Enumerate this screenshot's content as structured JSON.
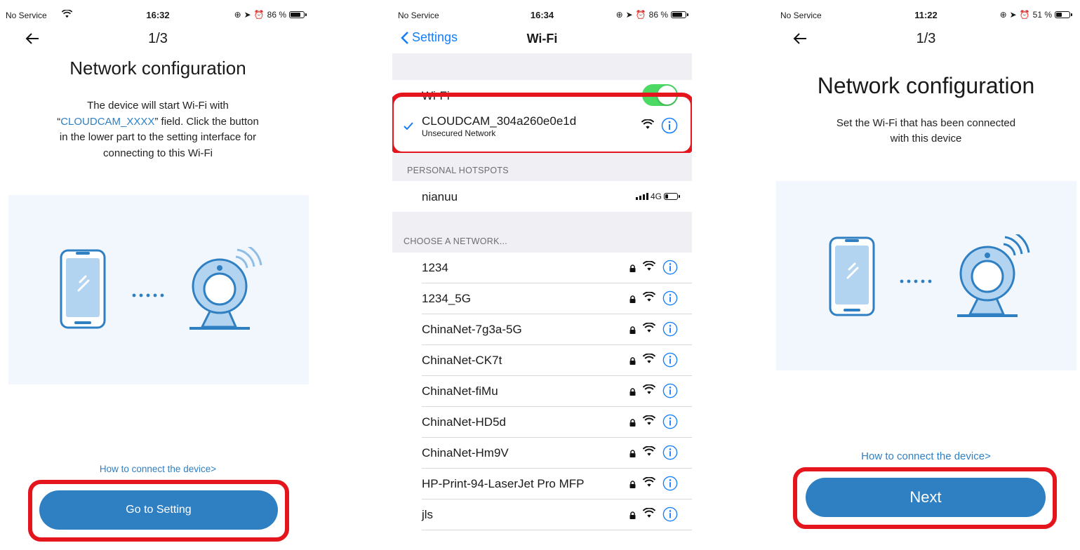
{
  "left_screen": {
    "status": {
      "carrier": "No Service",
      "time": "16:32",
      "battery": "86 %",
      "battery_level": 0.86
    },
    "back_icon": "arrow-left-icon",
    "step": "1/3",
    "title": "Network configuration",
    "description": {
      "open_quote": "“",
      "ssid": "CLOUDCAM_XXXX",
      "line1": "The device will start Wi-Fi with",
      "after_ssid": "” field. Click the button",
      "line3": "in the lower part to the setting interface for",
      "line4": "connecting to this Wi-Fi"
    },
    "help_link": "How to connect the device>",
    "button": "Go to Setting"
  },
  "middle_screen": {
    "status": {
      "carrier": "No Service",
      "time": "16:34",
      "battery": "86 %",
      "battery_level": 0.86
    },
    "back_label": "Settings",
    "title": "Wi-Fi",
    "wifi_label": "Wi-Fi",
    "wifi_enabled": true,
    "connected": {
      "ssid": "CLOUDCAM_304a260e0e1d",
      "subtitle": "Unsecured Network"
    },
    "hotspots_header": "PERSONAL HOTSPOTS",
    "hotspot": {
      "name": "nianuu",
      "network": "4G"
    },
    "choose_header": "CHOOSE A NETWORK...",
    "networks": [
      "1234",
      "1234_5G",
      "ChinaNet-7g3a-5G",
      "ChinaNet-CK7t",
      "ChinaNet-fiMu",
      "ChinaNet-HD5d",
      "ChinaNet-Hm9V",
      "HP-Print-94-LaserJet Pro MFP",
      "jls"
    ],
    "accent": "#147efb",
    "toggle_color": "#4cd964"
  },
  "right_screen": {
    "status": {
      "carrier": "No Service",
      "time": "11:22",
      "battery": "51 %",
      "battery_level": 0.51
    },
    "back_icon": "arrow-left-icon",
    "step": "1/3",
    "title": "Network configuration",
    "description_line1": "Set the Wi-Fi that has been connected",
    "description_line2": "with this device",
    "help_link": "How to connect the device>",
    "button": "Next"
  },
  "colors": {
    "brand_blue": "#2f7fc3",
    "highlight_red": "#e4151c",
    "illustration_bg": "#f2f7fd"
  }
}
